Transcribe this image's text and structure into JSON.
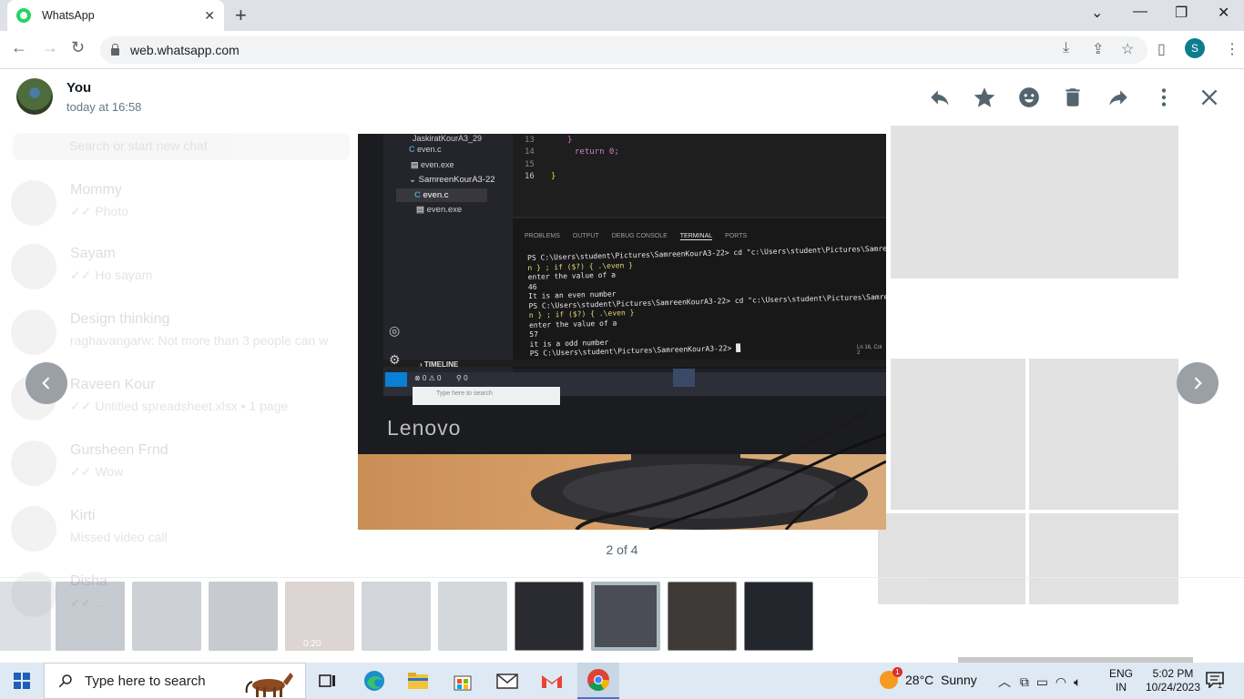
{
  "browser": {
    "tab_title": "WhatsApp",
    "url": "web.whatsapp.com",
    "profile_initial": "S"
  },
  "viewer": {
    "sender_name": "You",
    "sender_time": "today at 16:58",
    "counter": "2 of 4",
    "thumb_video_duration": "0:20"
  },
  "photo": {
    "tree": [
      "JaskiratKourA3_29",
      "even.c",
      "even.exe",
      "SamreenKourA3-22",
      "even.c",
      "even.exe"
    ],
    "code_lines": [
      {
        "num": "13",
        "text": "}"
      },
      {
        "num": "14",
        "text": "return 0;"
      },
      {
        "num": "15",
        "text": ""
      },
      {
        "num": "16",
        "text": "}"
      }
    ],
    "panel_tabs": [
      "PROBLEMS",
      "OUTPUT",
      "DEBUG CONSOLE",
      "TERMINAL",
      "PORTS"
    ],
    "terminal": [
      "PS C:\\Users\\student\\Pictures\\SamreenKourA3-22> cd \"c:\\Users\\student\\Pictures\\SamreenKour",
      "n } ; if ($?) { .\\even }",
      "enter the value of a",
      "46",
      "It is an even number",
      "PS C:\\Users\\student\\Pictures\\SamreenKourA3-22> cd \"c:\\Users\\student\\Pictures\\SamreenKour",
      "n } ; if ($?) { .\\even }",
      "enter the value of a",
      "57",
      "it is a odd number",
      "PS C:\\Users\\student\\Pictures\\SamreenKourA3-22> █"
    ],
    "timeline_label": "TIMELINE",
    "status_pos": "Ln 16, Col 2",
    "status_counts": "⊗ 0 ⚠ 0",
    "status_ports": "⚲ 0",
    "inner_search": "Type here to search",
    "brand": "Lenovo"
  },
  "background_chats": [
    {
      "name": "Mommy",
      "preview": "✓✓ Photo"
    },
    {
      "name": "Sayam",
      "preview": "✓✓ Ho sayam"
    },
    {
      "name": "Design thinking",
      "preview": "raghavangarw: Not more than 3 people can w"
    },
    {
      "name": "Raveen Kour",
      "preview": "✓✓ Untitled spreadsheet.xlsx • 1 page"
    },
    {
      "name": "Gursheen Frnd",
      "preview": "✓✓ Wow"
    },
    {
      "name": "Kirti",
      "preview": "Missed video call"
    },
    {
      "name": "Disha",
      "preview": "✓✓ ..."
    }
  ],
  "background_search_placeholder": "Search or start new chat",
  "taskbar": {
    "search_placeholder": "Type here to search",
    "weather_badge": "1",
    "weather": "28°C  Sunny",
    "lang_top": "ENG",
    "lang_bottom": "IN",
    "time": "5:02 PM",
    "date": "10/24/2023",
    "notif_count": "1"
  },
  "colors": {
    "whatsapp_green": "#25d366",
    "viewer_icon": "#54656f",
    "taskbar_bg": "#dfe9f3",
    "terminal_bg": "#1a1c22"
  }
}
